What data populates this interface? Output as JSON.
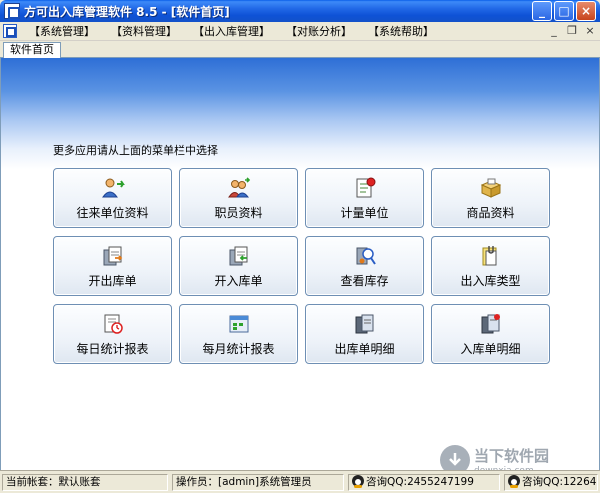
{
  "window": {
    "title": "方可出入库管理软件 8.5 - [软件首页]",
    "buttons": {
      "minimize": "_",
      "maximize": "□",
      "close": "×"
    }
  },
  "menu": {
    "items": [
      {
        "label": "【系统管理】"
      },
      {
        "label": "【资料管理】"
      },
      {
        "label": "【出入库管理】"
      },
      {
        "label": "【对账分析】"
      },
      {
        "label": "【系统帮助】"
      }
    ],
    "mdi_controls": {
      "minimize": "_",
      "restore": "❐",
      "close": "×"
    }
  },
  "tabs": [
    {
      "label": "软件首页"
    }
  ],
  "main": {
    "hint": "更多应用请从上面的菜单栏中选择",
    "tiles": [
      {
        "label": "往来单位资料",
        "icon": "people-arrow-icon"
      },
      {
        "label": "职员资料",
        "icon": "staff-icon"
      },
      {
        "label": "计量单位",
        "icon": "measure-icon"
      },
      {
        "label": "商品资料",
        "icon": "goods-box-icon"
      },
      {
        "label": "开出库单",
        "icon": "outbound-doc-icon"
      },
      {
        "label": "开入库单",
        "icon": "inbound-doc-icon"
      },
      {
        "label": "查看库存",
        "icon": "inventory-icon"
      },
      {
        "label": "出入库类型",
        "icon": "stock-type-icon"
      },
      {
        "label": "每日统计报表",
        "icon": "daily-report-icon"
      },
      {
        "label": "每月统计报表",
        "icon": "monthly-report-icon"
      },
      {
        "label": "出库单明细",
        "icon": "outbound-detail-icon"
      },
      {
        "label": "入库单明细",
        "icon": "inbound-detail-icon"
      }
    ]
  },
  "status": {
    "account": "当前帐套：默认账套",
    "operator": "操作员：[admin]系统管理员",
    "qq1": "咨询QQ:2455247199",
    "qq2": "咨询QQ:12264"
  },
  "watermark": {
    "main": "当下软件园",
    "sub": "downxia.com"
  },
  "colors": {
    "title_bar": "#0e52d6",
    "tile_border": "#6e8fb4",
    "content_gradient_top": "#2e6fd6"
  }
}
